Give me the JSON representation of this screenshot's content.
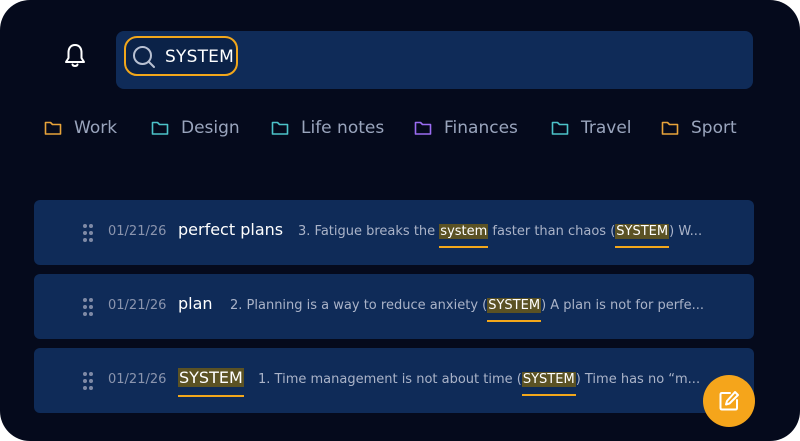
{
  "header": {
    "bell_icon": "bell-icon",
    "search": {
      "query": "SYSTEM",
      "icon": "search-icon"
    }
  },
  "folders": [
    {
      "label": "Work",
      "color": "#e8a33a"
    },
    {
      "label": "Design",
      "color": "#4cc3c9"
    },
    {
      "label": "Life notes",
      "color": "#4cc3c9"
    },
    {
      "label": "Finances",
      "color": "#9b6cf2"
    },
    {
      "label": "Travel",
      "color": "#4cc3c9"
    },
    {
      "label": "Sport",
      "color": "#e8a33a"
    }
  ],
  "notes": [
    {
      "date": "01/21/26",
      "title": "perfect plans",
      "excerpt_parts": [
        "3. Fatigue breaks the ",
        "system",
        " faster than chaos (",
        "SYSTEM",
        ") W..."
      ]
    },
    {
      "date": "01/21/26",
      "title": "plan",
      "excerpt_parts": [
        "2. Planning is a way to reduce anxiety (",
        "SYSTEM",
        ") A plan is not for perfe..."
      ]
    },
    {
      "date": "01/21/26",
      "title": "SYSTEM",
      "excerpt_parts": [
        "1. Time management is not about time (",
        "SYSTEM",
        ") Time has no “m..."
      ]
    }
  ],
  "fab": {
    "icon": "edit-icon"
  },
  "colors": {
    "background": "#050a1c",
    "card": "#0f2b58",
    "accent": "#f2a71b",
    "highlight": "#5b5224"
  }
}
